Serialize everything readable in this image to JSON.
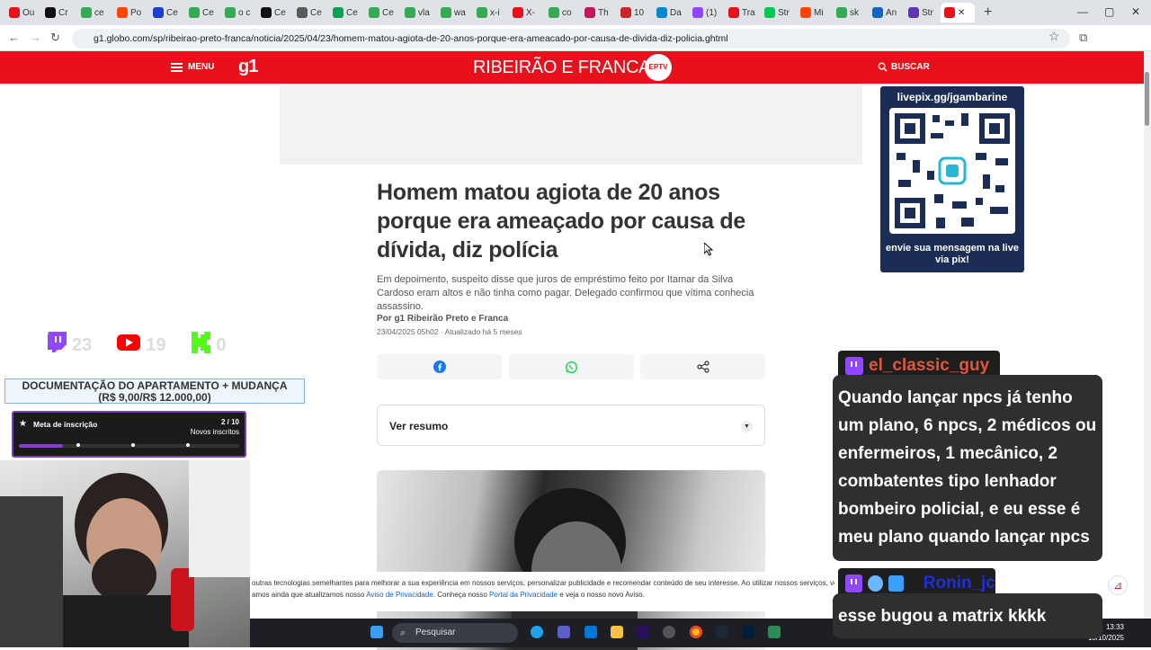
{
  "browser": {
    "tabs": [
      {
        "label": "Ou",
        "color": "#e8101b"
      },
      {
        "label": "Cr",
        "color": "#111111"
      },
      {
        "label": "ce",
        "color": "#34a853"
      },
      {
        "label": "Po",
        "color": "#ff4500"
      },
      {
        "label": "Ce",
        "color": "#1a3ecf"
      },
      {
        "label": "Ce",
        "color": "#34a853"
      },
      {
        "label": "o c",
        "color": "#34a853"
      },
      {
        "label": "Ce",
        "color": "#111111"
      },
      {
        "label": "Ce",
        "color": "#5a5a5a"
      },
      {
        "label": "Ce",
        "color": "#0f9d58"
      },
      {
        "label": "Ce",
        "color": "#34a853"
      },
      {
        "label": "vla",
        "color": "#34a853"
      },
      {
        "label": "wa",
        "color": "#34a853"
      },
      {
        "label": "x-i",
        "color": "#34a853"
      },
      {
        "label": "X-",
        "color": "#e8101b"
      },
      {
        "label": "co",
        "color": "#34a853"
      },
      {
        "label": "Th",
        "color": "#c2185b"
      },
      {
        "label": "10",
        "color": "#c62828"
      },
      {
        "label": "Da",
        "color": "#0288d1"
      },
      {
        "label": "(1)",
        "color": "#9146ff"
      },
      {
        "label": "Tra",
        "color": "#e8101b"
      },
      {
        "label": "Str",
        "color": "#00c853"
      },
      {
        "label": "Mi",
        "color": "#ff4500"
      },
      {
        "label": "sk",
        "color": "#34a853"
      },
      {
        "label": "An",
        "color": "#1565c0"
      },
      {
        "label": "Str",
        "color": "#5e35b1"
      }
    ],
    "active_tab": {
      "label": "",
      "color": "#e8101b"
    },
    "new_tab": "+",
    "win_min": "—",
    "win_max": "▢",
    "win_close": "✕",
    "back": "←",
    "forward": "→",
    "reload": "↻",
    "url": "g1.globo.com/sp/ribeirao-preto-franca/noticia/2025/04/23/homem-matou-agiota-de-20-anos-porque-era-ameacado-por-causa-de-divida-diz-policia.ghtml",
    "bookmark": "☆",
    "ext": "⧉"
  },
  "header": {
    "menu": "MENU",
    "logo": "g1",
    "brand": "RIBEIRÃO E FRANCA",
    "eptv": "EPTV",
    "search": "BUSCAR"
  },
  "article": {
    "title": "Homem matou agiota de 20 anos porque era ameaçado por causa de dívida, diz polícia",
    "subtitle": "Em depoimento, suspeito disse que juros de empréstimo feito por Itamar da Silva Cardoso eram altos e não tinha como pagar. Delegado confirmou que vítima conhecia assassino.",
    "byline": "Por g1 Ribeirão Preto e Franca",
    "date": "23/04/2025 05h02 · Atualizado há 5 meses",
    "summary_label": "Ver resumo"
  },
  "cookie": {
    "line1": "outras tecnologias semelhantes para melhorar a sua experiência em nossos serviços, personalizar publicidade e recomendar conteúdo de seu interesse. Ao utilizar nossos serviços, você está",
    "line2_a": "amos ainda que atualizamos nosso ",
    "link1": "Aviso de Privacidade",
    "line2_b": ". Conheça nosso ",
    "link2": "Portal da Privacidade",
    "line2_c": " e veja o nosso novo Aviso."
  },
  "taskbar": {
    "search": "Pesquisar",
    "time": "13:33",
    "date": "10/10/2025"
  },
  "stream": {
    "pix_url": "livepix.gg/jgambarine",
    "pix_msg": "envie sua mensagem na live via pix!",
    "counters": [
      {
        "icon": "twitch-icon",
        "value": "23",
        "color": "#9146ff"
      },
      {
        "icon": "youtube-icon",
        "value": "19",
        "color": "#ff0000"
      },
      {
        "icon": "kick-icon",
        "value": "0",
        "color": "#53fc18"
      }
    ],
    "goal": "DOCUMENTAÇÃO DO APARTAMENTO + MUDANÇA\n(R$ 9,00/R$ 12.000,00)",
    "meta_label": "Meta de inscrição",
    "meta_count": "2 / 10",
    "meta_sub": "Novos inscritos",
    "meta_progress": 0.2,
    "chat": [
      {
        "user": "el_classic_guy",
        "message": "Quando lançar npcs já tenho um plano, 6 npcs, 2 médicos ou enfermeiros, 1 mecânico, 2 combatentes tipo lenhador bombeiro policial, e eu esse é meu plano quando lançar npcs"
      },
      {
        "user": "Ronin_jc",
        "message": "esse bugou a matrix kkkk"
      }
    ]
  }
}
